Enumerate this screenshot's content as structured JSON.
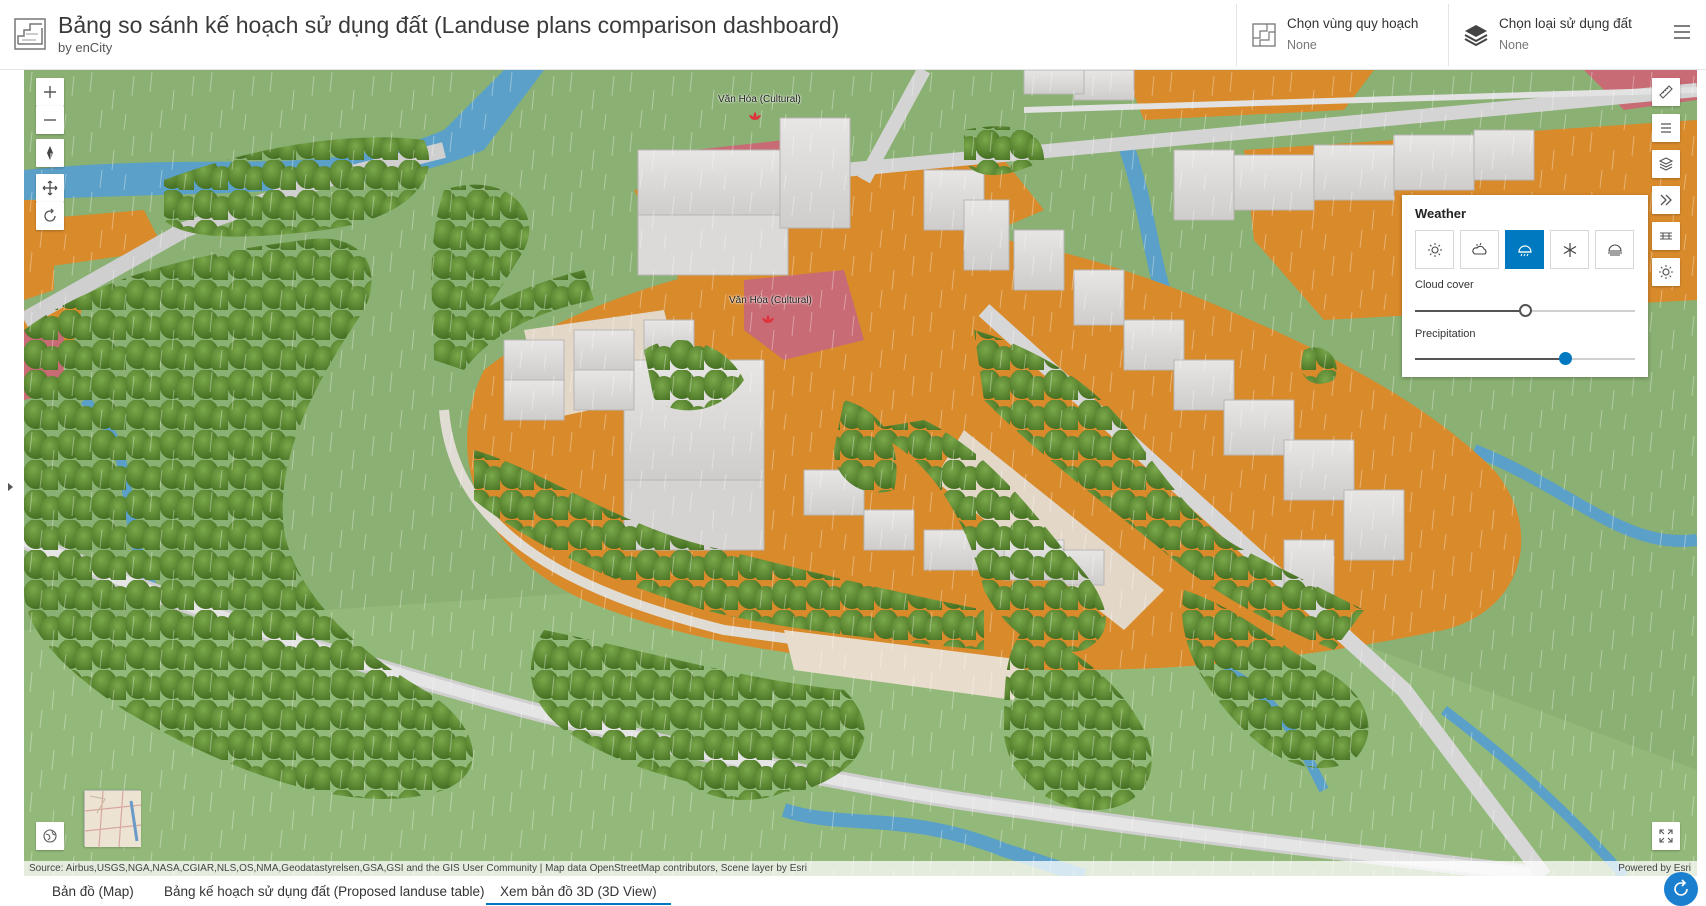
{
  "header": {
    "title": "Bảng so sánh kế hoạch sử dụng đất (Landuse plans comparison dashboard)",
    "subtitle": "by enCity",
    "planning_area": {
      "label": "Chọn vùng quy hoạch",
      "value": "None"
    },
    "landuse_type": {
      "label": "Chọn loại sử dụng đất",
      "value": "None"
    }
  },
  "map": {
    "labels": [
      "Văn Hóa (Cultural)",
      "Văn Hóa (Cultural)"
    ],
    "attribution": "Source: Airbus,USGS,NGA,NASA,CGIAR,NLS,OS,NMA,Geodatastyrelsen,GSA,GSI and the GIS User Community | Map data OpenStreetMap contributors, Scene layer by Esri",
    "powered_by": "Powered by Esri"
  },
  "weather": {
    "title": "Weather",
    "options": [
      "sunny-icon",
      "cloudy-icon",
      "rainy-icon",
      "snowy-icon",
      "foggy-icon"
    ],
    "selected": "rainy",
    "cloud_cover_label": "Cloud cover",
    "cloud_cover": 0.5,
    "precipitation_label": "Precipitation",
    "precipitation": 0.68
  },
  "tabs": [
    {
      "label": "Bản đồ (Map)",
      "active": false
    },
    {
      "label": "Bảng kế hoạch sử dụng đất (Proposed landuse table)",
      "active": false
    },
    {
      "label": "Xem bản đồ 3D (3D View)",
      "active": true
    }
  ],
  "colors": {
    "accent": "#0079c1",
    "residential": "#d98a2b",
    "green": "#8bb073",
    "water": "#5aa0c8",
    "tree": "#5a8a2e",
    "cultural": "#c86b74"
  }
}
